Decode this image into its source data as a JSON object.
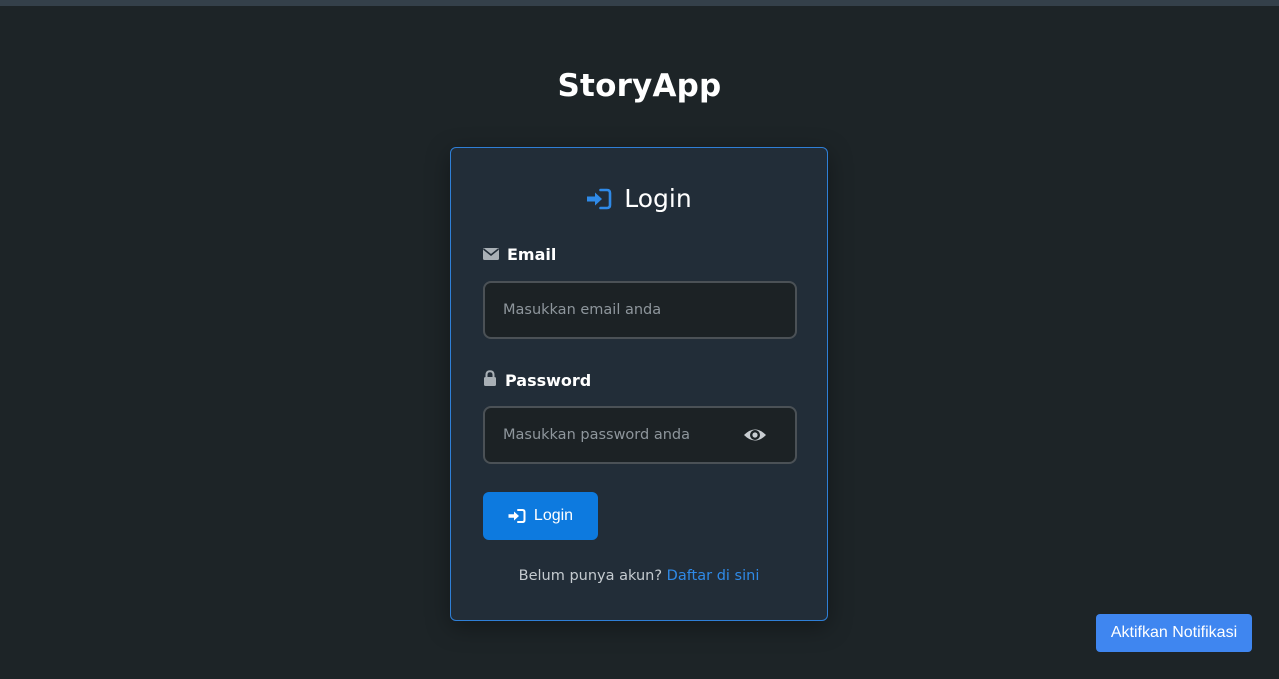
{
  "app": {
    "title": "StoryApp"
  },
  "login_card": {
    "heading": "Login",
    "heading_icon": "sign-in-icon",
    "email": {
      "label": "Email",
      "icon": "envelope-icon",
      "placeholder": "Masukkan email anda",
      "value": ""
    },
    "password": {
      "label": "Password",
      "icon": "lock-icon",
      "placeholder": "Masukkan password anda",
      "value": "",
      "toggle_icon": "eye-icon"
    },
    "submit_label": "Login",
    "register_prompt": "Belum punya akun?",
    "register_link": "Daftar di sini"
  },
  "notification_button": {
    "label": "Aktifkan Notifikasi"
  },
  "colors": {
    "background": "#1d2427",
    "card": "#222d38",
    "card_border": "#2f7fd6",
    "primary_button": "#0d7adf",
    "link": "#2f8ae8",
    "notification_button": "#3f86f0"
  }
}
